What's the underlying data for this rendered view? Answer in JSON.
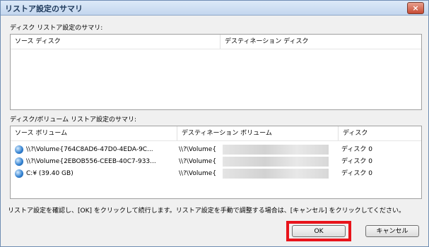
{
  "window": {
    "title": "リストア設定のサマリ",
    "close_label": "×"
  },
  "disk_summary": {
    "label": "ディスク リストア設定のサマリ:",
    "columns": [
      "ソース ディスク",
      "デスティネーション ディスク"
    ]
  },
  "volume_summary": {
    "label": "ディスク/ボリューム リストア設定のサマリ:",
    "columns": [
      "ソース ボリューム",
      "デスティネーション ボリューム",
      "ディスク"
    ],
    "rows": [
      {
        "source": "\\\\?\\Volume{764C8AD6-47D0-4EDA-9C...",
        "destination": "\\\\?\\Volume{",
        "disk": "ディスク 0"
      },
      {
        "source": "\\\\?\\Volume{2EBOB556-CEEB-40C7-933...",
        "destination": "\\\\?\\Volume{",
        "disk": "ディスク 0"
      },
      {
        "source": "C:¥ (39.40 GB)",
        "destination": "\\\\?\\Volume{",
        "disk": "ディスク 0"
      }
    ]
  },
  "instruction": "リストア設定を確認し、[OK] をクリックして続行します。リストア設定を手動で調整する場合は、[キャンセル] をクリックしてください。",
  "buttons": {
    "ok": "OK",
    "cancel": "キャンセル"
  },
  "colors": {
    "highlight": "#e8141b",
    "titlebar": "#c3d6ee"
  },
  "icons": {
    "volume": "disk-volume-icon",
    "close": "close-icon"
  }
}
